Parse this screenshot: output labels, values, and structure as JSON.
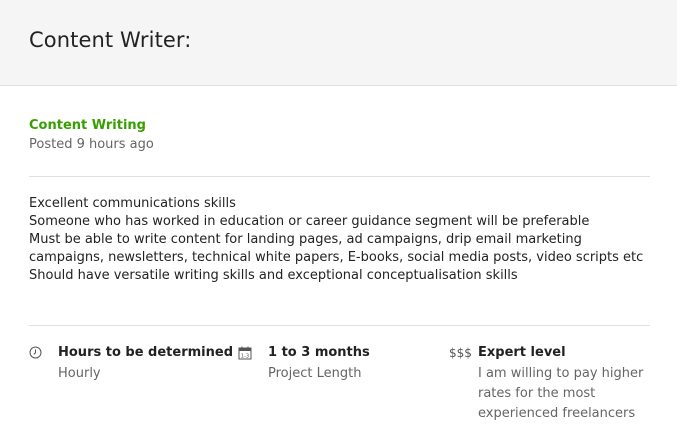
{
  "header": {
    "title": "Content Writer:"
  },
  "job": {
    "category": "Content Writing",
    "posted": "Posted 9 hours ago",
    "description_lines": [
      "Excellent communications skills",
      "Someone who has worked in education or career guidance segment will be preferable",
      "Must be able to write content for landing pages, ad campaigns, drip email marketing campaigns, newsletters, technical white papers, E-books, social media posts, video scripts etc",
      "Should have versatile writing skills and exceptional conceptualisation skills"
    ]
  },
  "features": {
    "hours": {
      "icon": "clock-icon",
      "title": "Hours to be determined",
      "subtitle": "Hourly"
    },
    "duration": {
      "icon": "calendar-icon",
      "title": "1 to 3 months",
      "subtitle": "Project Length"
    },
    "level": {
      "icon_text": "$$$",
      "title": "Expert level",
      "subtitle": "I am willing to pay higher rates for the most experienced freelancers"
    }
  },
  "colors": {
    "accent": "#37a000",
    "muted": "#656565",
    "header_bg": "#f5f5f5"
  }
}
